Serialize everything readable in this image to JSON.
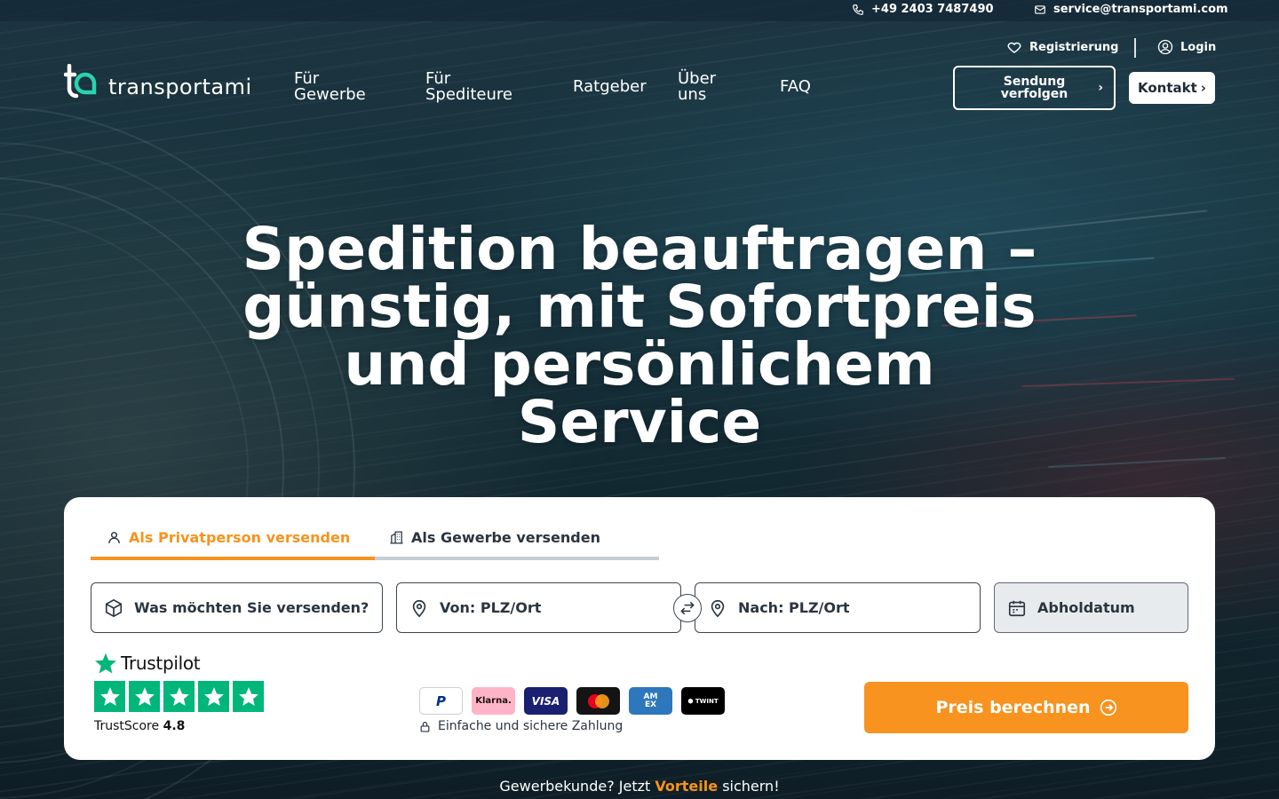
{
  "topbar": {
    "phone": "+49 2403 7487490",
    "email": "service@transportami.com"
  },
  "account": {
    "register_label": "Registrierung",
    "login_label": "Login"
  },
  "brand": {
    "logo_text": "transportami"
  },
  "nav": {
    "items": [
      {
        "label": "Für\nGewerbe"
      },
      {
        "label": "Für\nSpediteure"
      },
      {
        "label": "Ratgeber"
      },
      {
        "label": "Über\nuns"
      },
      {
        "label": "FAQ"
      }
    ],
    "track_label": "Sendung verfolgen",
    "contact_label": "Kontakt"
  },
  "hero": {
    "title": "Spedition beauftragen – günstig, mit Sofortpreis und persönlichem Service"
  },
  "booking": {
    "tabs": [
      {
        "label": "Als Privatperson versenden",
        "active": true
      },
      {
        "label": "Als Gewerbe versenden",
        "active": false
      }
    ],
    "fields": {
      "what": "Was möchten Sie versenden?",
      "from": "Von: PLZ/Ort",
      "to": "Nach: PLZ/Ort",
      "date": "Abholdatum"
    },
    "cta_label": "Preis berechnen",
    "payment_note": "Einfache und sichere Zahlung",
    "payment_methods": [
      "PayPal",
      "Klarna",
      "VISA",
      "Mastercard",
      "American Express",
      "TWINT"
    ]
  },
  "trustpilot": {
    "brand": "Trustpilot",
    "score_label": "TrustScore",
    "score_value": "4.8",
    "stars": 5
  },
  "footer_note": {
    "prefix": "Gewerbekunde? Jetzt",
    "highlight": "Vorteile",
    "suffix": "sichern!"
  },
  "colors": {
    "accent": "#f7931e",
    "trustpilot_green": "#00b67a",
    "text_dark": "#2a3540",
    "tab_inactive_line": "#c8cdd2"
  }
}
